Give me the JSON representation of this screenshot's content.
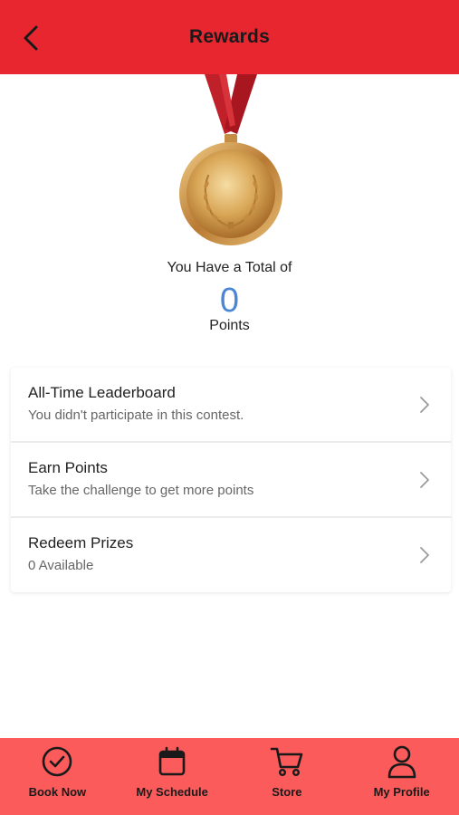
{
  "header": {
    "title": "Rewards",
    "back_icon": "chevron-left-icon",
    "background": "#e8262f"
  },
  "summary": {
    "total_label": "You Have a Total of",
    "points_value": "0",
    "points_label": "Points",
    "points_color": "#4a86d4",
    "medal_icon": "gold-medal-icon"
  },
  "menu": {
    "items": [
      {
        "title": "All-Time Leaderboard",
        "subtitle": "You didn't participate in this contest."
      },
      {
        "title": "Earn Points",
        "subtitle": "Take the challenge to get more points"
      },
      {
        "title": "Redeem Prizes",
        "subtitle": "0 Available"
      }
    ]
  },
  "tabbar": {
    "background": "#fb5b5b",
    "tabs": [
      {
        "label": "Book Now",
        "icon": "check-circle-icon"
      },
      {
        "label": "My Schedule",
        "icon": "calendar-icon"
      },
      {
        "label": "Store",
        "icon": "cart-icon"
      },
      {
        "label": "My Profile",
        "icon": "user-icon"
      }
    ]
  }
}
